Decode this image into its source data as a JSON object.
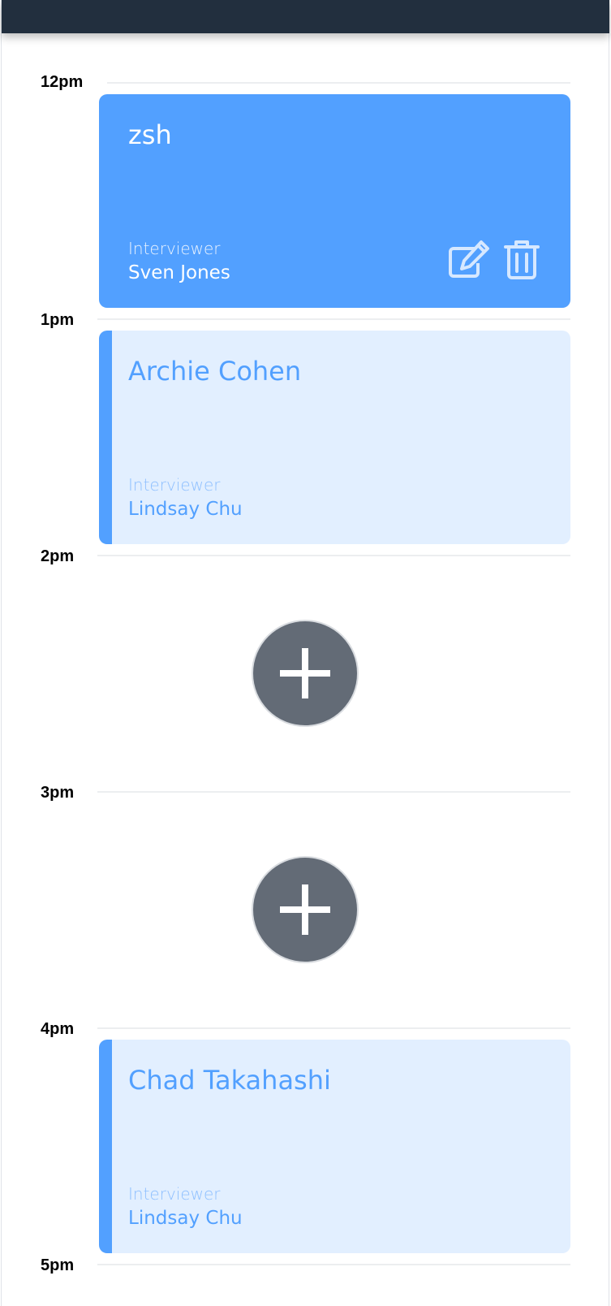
{
  "time_slots": [
    {
      "label": "12pm"
    },
    {
      "label": "1pm"
    },
    {
      "label": "2pm"
    },
    {
      "label": "3pm"
    },
    {
      "label": "4pm"
    },
    {
      "label": "5pm"
    }
  ],
  "appointments": [
    {
      "student": "zsh",
      "interviewer_label": "Interviewer",
      "interviewer": "Sven Jones",
      "selected": true
    },
    {
      "student": "Archie Cohen",
      "interviewer_label": "Interviewer",
      "interviewer": "Lindsay Chu",
      "selected": false
    },
    {
      "student": "Chad Takahashi",
      "interviewer_label": "Interviewer",
      "interviewer": "Lindsay Chu",
      "selected": false
    }
  ],
  "icons": {
    "edit": "edit-icon",
    "delete": "trash-icon",
    "add": "plus-icon"
  },
  "colors": {
    "topbar": "#222f3e",
    "accent": "#52a0ff",
    "card_light": "#e2efff",
    "add_button": "#636b76"
  }
}
